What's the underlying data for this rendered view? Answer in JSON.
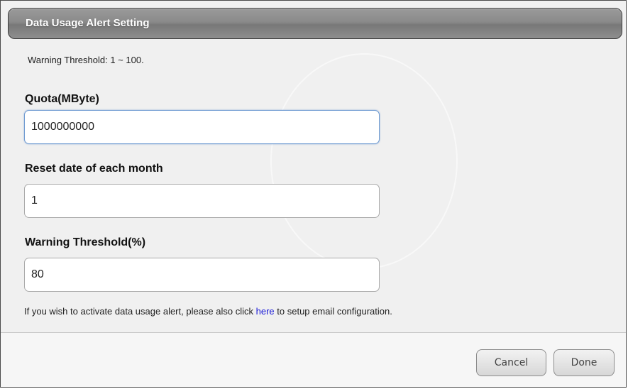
{
  "dialog": {
    "title": "Data Usage Alert Setting",
    "note": "Warning Threshold: 1 ~ 100.",
    "fields": [
      {
        "label": "Quota(MByte)",
        "value": "1000000000"
      },
      {
        "label": "Reset date of each month",
        "value": "1"
      },
      {
        "label": "Warning Threshold(%)",
        "value": "80"
      }
    ],
    "info": {
      "before": "If you wish to activate data usage alert, please also click ",
      "link": "here",
      "after": " to setup email configuration."
    },
    "buttons": {
      "cancel": "Cancel",
      "done": "Done"
    }
  },
  "colors": {
    "link": "#1a1ad6",
    "focus_border": "#6e9ad1"
  }
}
